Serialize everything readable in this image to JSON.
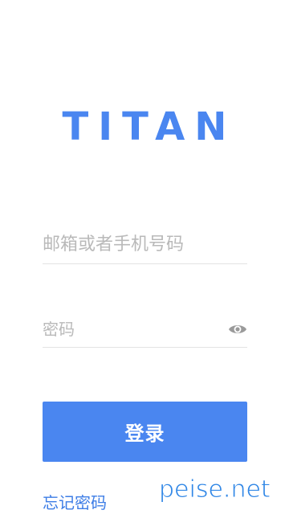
{
  "app": {
    "logo_text": "TITAN"
  },
  "form": {
    "account_placeholder": "邮箱或者手机号码",
    "account_value": "",
    "password_placeholder": "密码",
    "password_value": "",
    "login_label": "登录",
    "forgot_label": "忘记密码"
  },
  "icons": {
    "password_toggle": "eye-icon"
  },
  "watermark": {
    "text": "peise.net"
  },
  "colors": {
    "brand": "#4a86f0",
    "watermark": "#2f86e6"
  }
}
